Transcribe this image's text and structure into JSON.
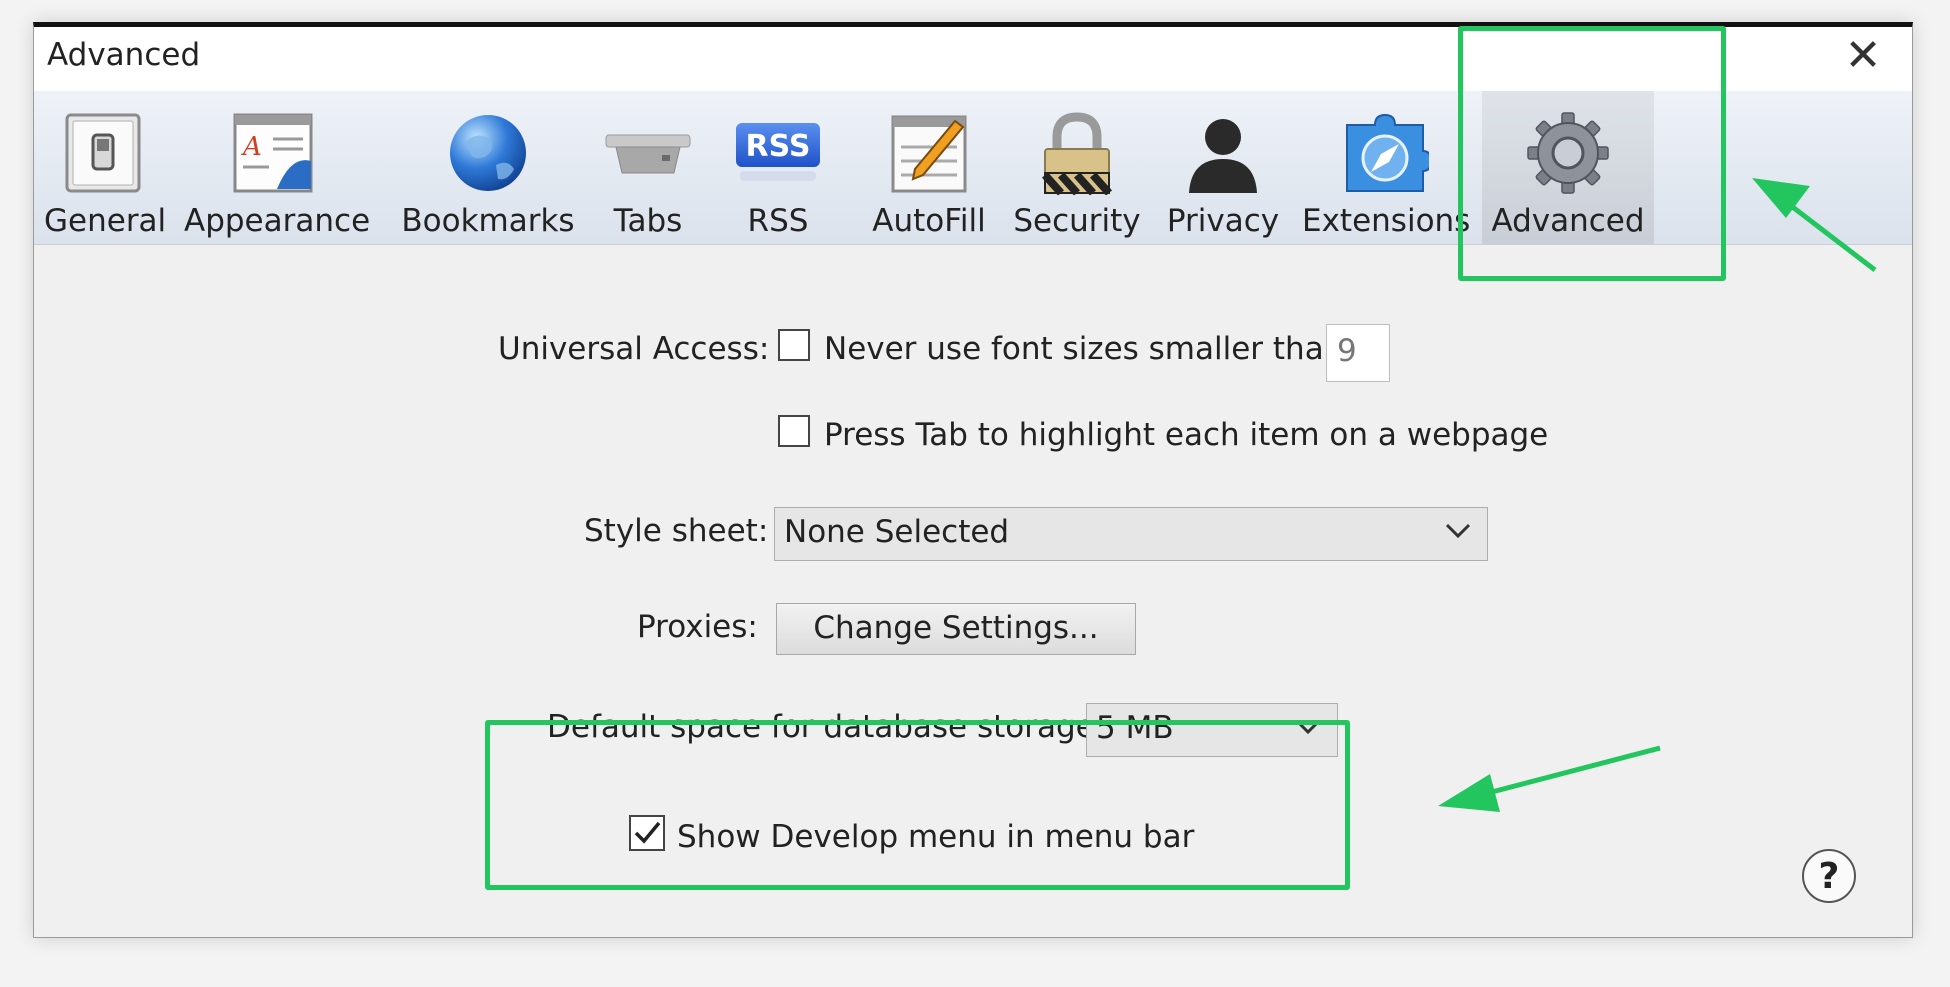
{
  "window": {
    "title": "Advanced",
    "close_glyph": "✕"
  },
  "toolbar": {
    "items": [
      {
        "label": "General",
        "icon": "switch-icon"
      },
      {
        "label": "Appearance",
        "icon": "appearance-icon"
      },
      {
        "label": "Bookmarks",
        "icon": "globe-icon"
      },
      {
        "label": "Tabs",
        "icon": "tabs-icon"
      },
      {
        "label": "RSS",
        "icon": "rss-icon",
        "badge": "RSS"
      },
      {
        "label": "AutoFill",
        "icon": "pencil-form-icon"
      },
      {
        "label": "Security",
        "icon": "lock-icon"
      },
      {
        "label": "Privacy",
        "icon": "person-icon"
      },
      {
        "label": "Extensions",
        "icon": "puzzle-compass-icon"
      },
      {
        "label": "Advanced",
        "icon": "gear-icon",
        "selected": true
      }
    ]
  },
  "universal_access": {
    "label": "Universal Access:",
    "min_font": {
      "label": "Never use font sizes smaller than",
      "checked": false,
      "value": "9"
    },
    "tab_highlight": {
      "label": "Press Tab to highlight each item on a webpage",
      "checked": false
    }
  },
  "style_sheet": {
    "label": "Style sheet:",
    "value": "None Selected"
  },
  "proxies": {
    "label": "Proxies:",
    "button": "Change Settings..."
  },
  "database": {
    "label": "Default space for database storage:",
    "value": "5 MB"
  },
  "develop_menu": {
    "label": "Show Develop menu in menu bar",
    "checked": true
  },
  "help": {
    "glyph": "?"
  },
  "colors": {
    "highlight": "#22c55e",
    "selected_tab": "#c9ced6"
  }
}
